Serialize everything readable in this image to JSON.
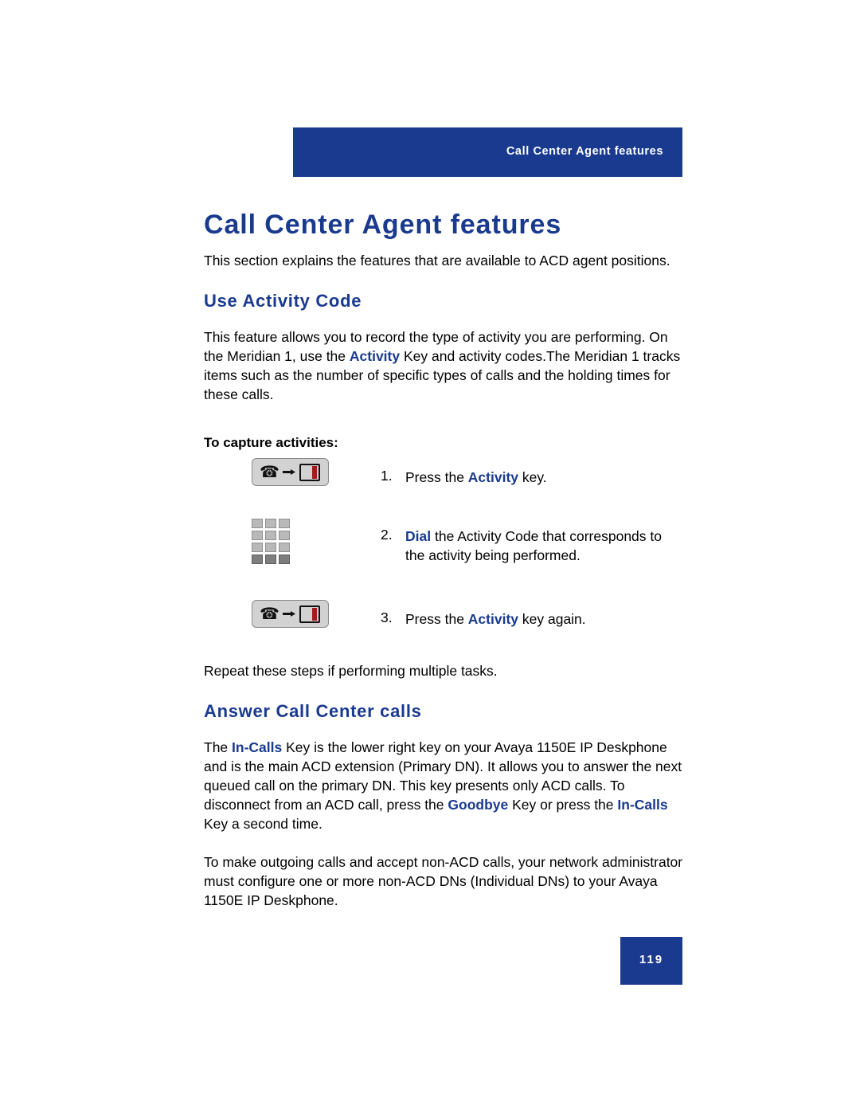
{
  "header": {
    "running_head": "Call Center Agent features"
  },
  "title": "Call Center Agent features",
  "intro": {
    "text": "This section explains the features that are available to ACD agent positions."
  },
  "sections": [
    {
      "heading": "Use Activity Code",
      "paragraph_parts": [
        "This feature allows you to record the type of activity you are performing. On the Meridian 1, use the ",
        "Activity",
        " Key and activity codes.The Meridian 1 tracks items such as the number of specific types of calls and the holding times for these calls."
      ],
      "sub_heading": "To capture activities:",
      "steps": [
        {
          "number": "1.",
          "icon": "activity-key-icon",
          "parts": [
            "Press the ",
            "Activity",
            " key."
          ]
        },
        {
          "number": "2.",
          "icon": "keypad-icon",
          "parts": [
            "",
            "Dial",
            " the Activity Code that corresponds to the activity being performed."
          ]
        },
        {
          "number": "3.",
          "icon": "activity-key-icon",
          "parts": [
            "Press the ",
            "Activity",
            " key again."
          ]
        }
      ],
      "closing": "Repeat these steps if performing multiple tasks."
    },
    {
      "heading": "Answer Call Center calls",
      "paragraph1_parts": [
        "The ",
        "In-Calls",
        " Key is the lower right key on your Avaya 1150E IP Deskphone and is the main ACD extension (Primary DN). It allows you to answer the next queued call on the primary DN. This key presents only ACD calls. To disconnect from an ACD call, press the ",
        "Goodbye",
        " Key or press the ",
        "In-Calls",
        " Key a second time."
      ],
      "paragraph2": "To make outgoing calls and accept non-ACD calls, your network administrator must configure one or more non-ACD DNs (Individual DNs) to your Avaya 1150E IP Deskphone."
    }
  ],
  "page_number": "119",
  "colors": {
    "accent_blue": "#1a3a8f",
    "key_icon_body": "#d2d2d2",
    "key_icon_red": "#a51b1b"
  }
}
